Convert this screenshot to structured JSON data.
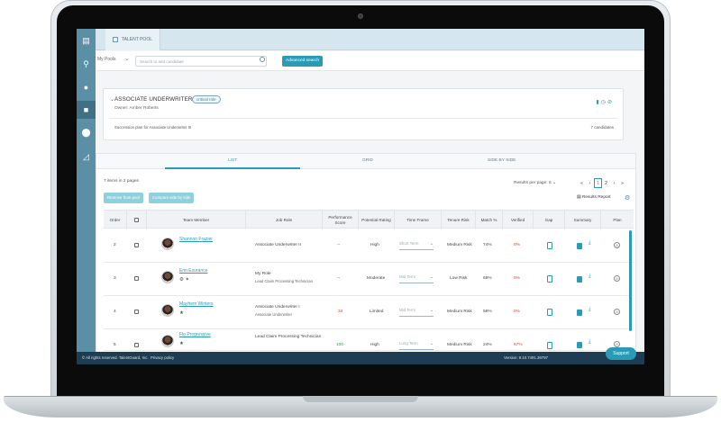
{
  "topbar": {
    "tab_label": "TALENT POOL"
  },
  "filter": {
    "pools_label": "My Pools",
    "search_placeholder": "Search to add candidate",
    "advanced_search": "Advanced search"
  },
  "role": {
    "title": "ASSOCIATE UNDERWRITER III",
    "badge": "critical role",
    "owner": "Owner: Amber Roberts",
    "plan": "Succession plan for Associate Underwriter III",
    "candidates": "7 candidates"
  },
  "views": {
    "list": "LIST",
    "grid": "GRID",
    "side_by_side": "SIDE BY SIDE"
  },
  "list": {
    "items_count": "7 items in 2 pages",
    "results_per_page": "Results per page:",
    "rpp_value": "6",
    "pages": [
      "1",
      "2"
    ],
    "current_page": "1",
    "results_report": "Results Report",
    "remove_btn": "Remove from pool",
    "compare_btn": "Compare side by side"
  },
  "table": {
    "headers": {
      "order": "Order",
      "member": "Team Member",
      "job": "Job Role",
      "perf": "Performance Score",
      "potential": "Potential Rating",
      "timeframe": "Time Frame",
      "tenure": "Tenure Risk",
      "match": "Match %",
      "verified": "Verified",
      "gap": "Gap",
      "summary": "Summary",
      "plan": "Plan"
    },
    "rows": [
      {
        "order": "2",
        "name": "Shannon Frazier",
        "job": "Associate Underwriter II",
        "job_sub": "",
        "perf": "--",
        "potential": "High",
        "timeframe": "Short Term",
        "tenure": "Medium Risk",
        "match": "74%",
        "verified": "0%"
      },
      {
        "order": "3",
        "name": "Erin Esurance",
        "job": "My Role",
        "job_sub": "Lead Claim Processing Technician",
        "perf": "--",
        "potential": "Moderate",
        "timeframe": "Mid Term",
        "tenure": "Low Risk",
        "match": "68%",
        "verified": "0%"
      },
      {
        "order": "4",
        "name": "Mayhem Winters",
        "job": "Associate Underwriter I",
        "job_sub": "Associate Underwriter",
        "perf": "34",
        "potential": "Limited",
        "timeframe": "Mid Term",
        "tenure": "Medium Risk",
        "match": "58%",
        "verified": "0%"
      },
      {
        "order": "5",
        "name": "Flo Progressive",
        "job": "Lead Claim Processing Technician",
        "job_sub": "",
        "perf": "100",
        "potential": "High",
        "timeframe": "Long Term",
        "tenure": "Medium Risk",
        "match": "24%",
        "verified": "67%"
      }
    ]
  },
  "footer": {
    "rights": "© All rights reserved. TalentGuard, Inc.",
    "privacy": "Privacy policy",
    "version": "Version: 9.10.7491.39797",
    "support": "Support"
  },
  "colors": {
    "accent": "#2a9bb4",
    "rail": "#5a8fa6",
    "footer": "#1f3d52",
    "danger": "#e53935",
    "success": "#2e9b3e"
  }
}
